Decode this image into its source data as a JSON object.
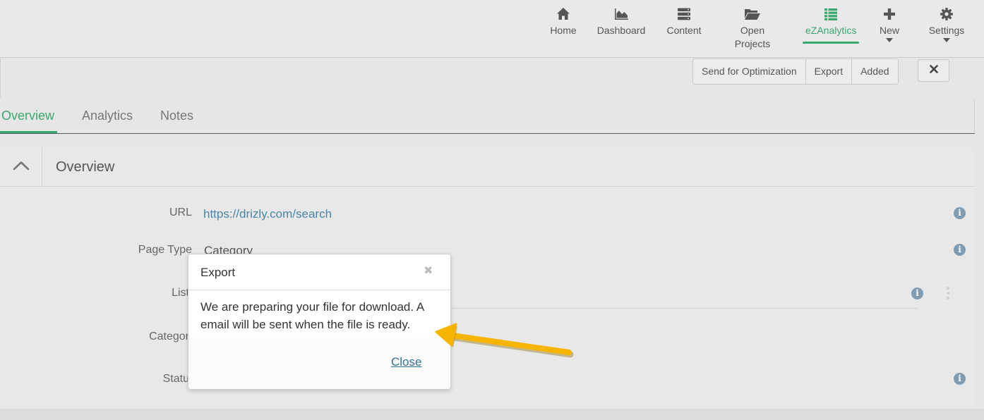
{
  "nav": {
    "items": [
      {
        "label": "Home",
        "icon": "home-icon"
      },
      {
        "label": "Dashboard",
        "icon": "area-chart-icon"
      },
      {
        "label": "Content",
        "icon": "server-icon"
      },
      {
        "label": "Open Projects",
        "line1": "Open",
        "line2": "Projects",
        "icon": "folder-open-icon"
      },
      {
        "label": "eZAnalytics",
        "icon": "list-icon",
        "active": true
      },
      {
        "label": "New",
        "icon": "plus-icon"
      },
      {
        "label": "Settings",
        "icon": "gear-icon"
      }
    ],
    "accent_color": "#3aa76d"
  },
  "toolbar": {
    "send_label": "Send for Optimization",
    "export_label": "Export",
    "added_label": "Added",
    "close_icon": "close-icon"
  },
  "tabs": [
    {
      "label": "Overview",
      "active": true
    },
    {
      "label": "Analytics"
    },
    {
      "label": "Notes"
    }
  ],
  "panel": {
    "title": "Overview",
    "fields": {
      "url": {
        "label": "URL",
        "value": "https://drizly.com/search"
      },
      "page_type": {
        "label": "Page Type",
        "value": "Category"
      },
      "list": {
        "label": "List"
      },
      "category": {
        "label": "Categor"
      },
      "status": {
        "label": "Statu"
      }
    }
  },
  "modal": {
    "title": "Export",
    "close_x": "✖",
    "message": "We are preparing your file for download. A email will be sent when the file is ready.",
    "close_label": "Close"
  },
  "annotation": {
    "arrow_color": "#f5b400"
  }
}
